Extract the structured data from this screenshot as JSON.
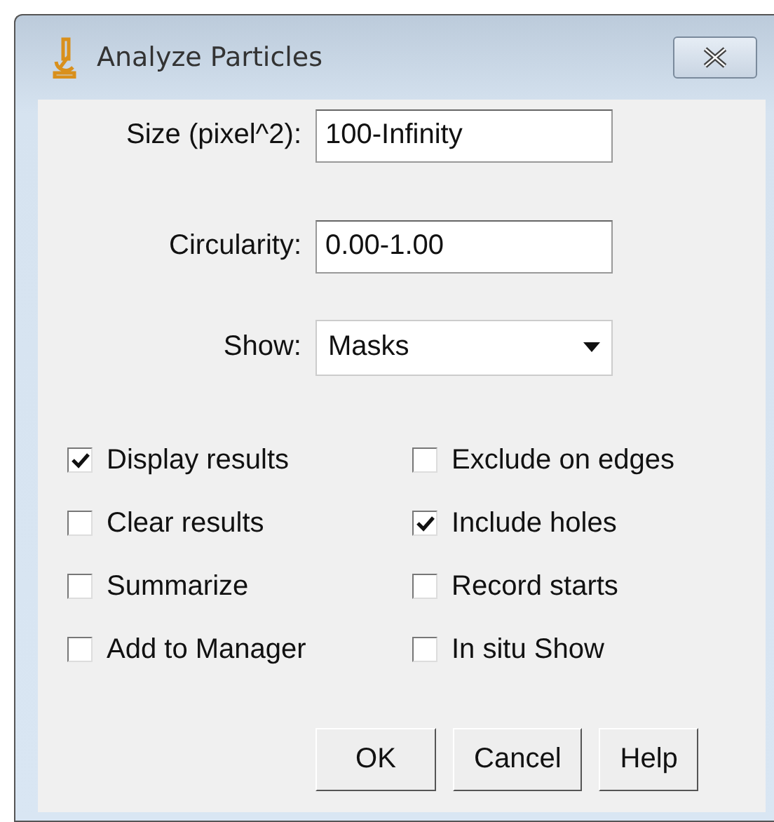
{
  "window": {
    "title": "Analyze Particles"
  },
  "fields": [
    {
      "label": "Size (pixel^2):",
      "value": "100-Infinity"
    },
    {
      "label": "Circularity:",
      "value": "0.00-1.00"
    }
  ],
  "show": {
    "label": "Show:",
    "value": "Masks"
  },
  "options": [
    {
      "label": "Display results",
      "checked": true
    },
    {
      "label": "Exclude on edges",
      "checked": false
    },
    {
      "label": "Clear results",
      "checked": false
    },
    {
      "label": "Include holes",
      "checked": true
    },
    {
      "label": "Summarize",
      "checked": false
    },
    {
      "label": "Record starts",
      "checked": false
    },
    {
      "label": "Add to Manager",
      "checked": false
    },
    {
      "label": "In situ Show",
      "checked": false
    }
  ],
  "buttons": [
    "OK",
    "Cancel",
    "Help"
  ]
}
